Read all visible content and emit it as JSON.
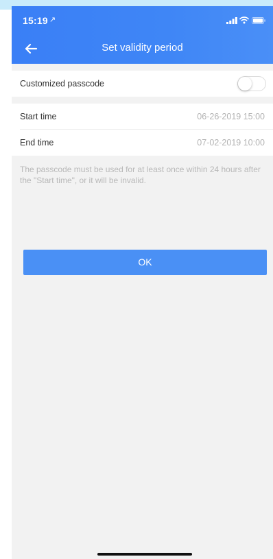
{
  "status_bar": {
    "time": "15:19",
    "location_icon": "location-arrow-icon",
    "signal_icon": "cellular-signal-icon",
    "wifi_icon": "wifi-icon",
    "battery_icon": "battery-icon"
  },
  "nav": {
    "back_icon": "arrow-left-icon",
    "title": "Set validity period"
  },
  "settings": {
    "customized_passcode": {
      "label": "Customized passcode",
      "enabled": false
    },
    "start_time": {
      "label": "Start time",
      "value": "06-26-2019 15:00"
    },
    "end_time": {
      "label": "End time",
      "value": "07-02-2019 10:00"
    }
  },
  "hint": "The passcode must be used for at least once within 24 hours after the \"Start time\", or it will be invalid.",
  "ok_button": {
    "label": "OK"
  },
  "colors": {
    "header": "#3f86f6",
    "button": "#4a90f5",
    "background": "#f2f2f2",
    "hint_text": "#b8b8b8"
  }
}
